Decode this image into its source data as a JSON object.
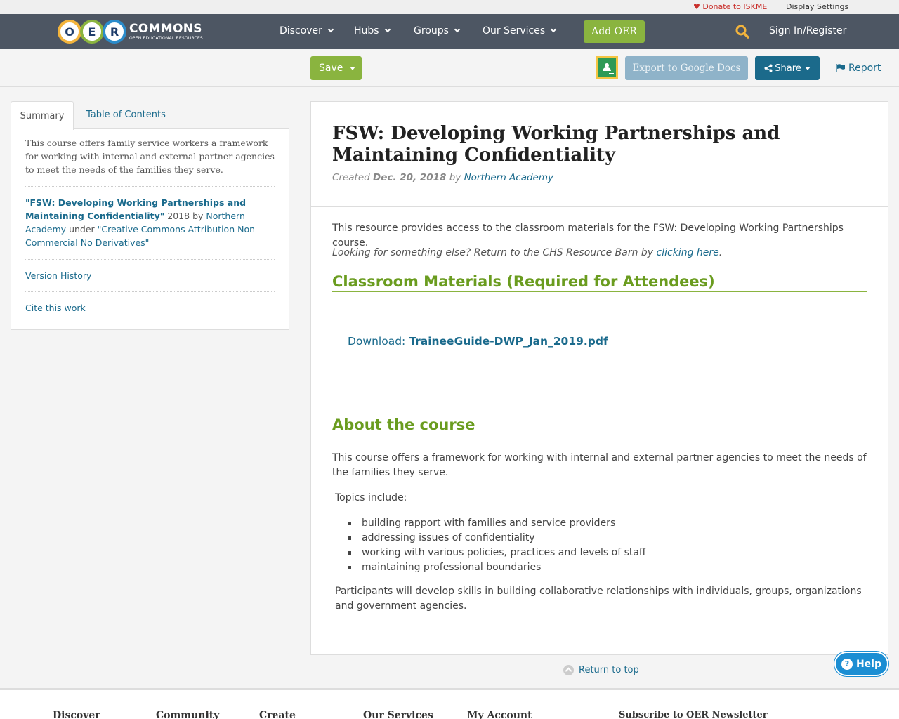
{
  "utility": {
    "donate": "Donate to ISKME",
    "display_settings": "Display Settings"
  },
  "nav": {
    "logo_word": "COMMONS",
    "logo_sub": "OPEN EDUCATIONAL RESOURCES",
    "logo_letters": [
      "O",
      "E",
      "R"
    ],
    "items": [
      "Discover",
      "Hubs",
      "Groups",
      "Our Services"
    ],
    "add_oer": "Add OER",
    "signin": "Sign In/Register"
  },
  "toolbar": {
    "save": "Save",
    "export": "Export to Google Docs",
    "share": "Share",
    "report": "Report"
  },
  "left": {
    "tabs": [
      "Summary",
      "Table of Contents"
    ],
    "summary": "This course offers family service workers a framework for working with internal and external partner agencies to meet the needs of the families they serve.",
    "attribution": {
      "title": "\"FSW: Developing Working Partnerships and Maintaining Confidentiality\"",
      "year": "2018 by",
      "author": "Northern Academy",
      "under": "under",
      "license": "\"Creative Commons Attribution Non-Commercial No Derivatives\""
    },
    "version_history": "Version History",
    "cite": "Cite this work"
  },
  "main": {
    "title": "FSW: Developing Working Partnerships and Maintaining Confidentiality",
    "created_label": "Created",
    "created_date": "Dec. 20, 2018",
    "by": "by",
    "author": "Northern Academy",
    "intro": "This resource provides access to the classroom materials for the FSW: Developing Working Partnerships course.",
    "looking": "Looking for something else? Return to the CHS Resource Barn by",
    "clicking_here": "clicking here",
    "period": ".",
    "section1": "Classroom Materials (Required for Attendees)",
    "download_label": "Download:",
    "download_file": "TraineeGuide-DWP_Jan_2019.pdf",
    "section2": "About the course",
    "about": "This course offers a framework for working with internal and external partner agencies to meet the needs of the families they serve.",
    "topics_label": "Topics include:",
    "topics": [
      "building rapport with families and service providers",
      "addressing issues of confidentiality",
      "working with various policies, practices and levels of staff",
      "maintaining professional boundaries"
    ],
    "participants": "Participants will develop skills in building collaborative relationships with individuals, groups, organizations and government agencies."
  },
  "return_top": "Return to top",
  "help": "Help",
  "footer": {
    "headings": [
      "Discover",
      "Community",
      "Create",
      "Our Services",
      "My Account"
    ],
    "newsletter": "Subscribe to OER Newsletter"
  },
  "colors": {
    "nav_bg": "#4d5663",
    "green": "#8ab43f",
    "link": "#1a6a8c",
    "share": "#1b6a8b"
  }
}
